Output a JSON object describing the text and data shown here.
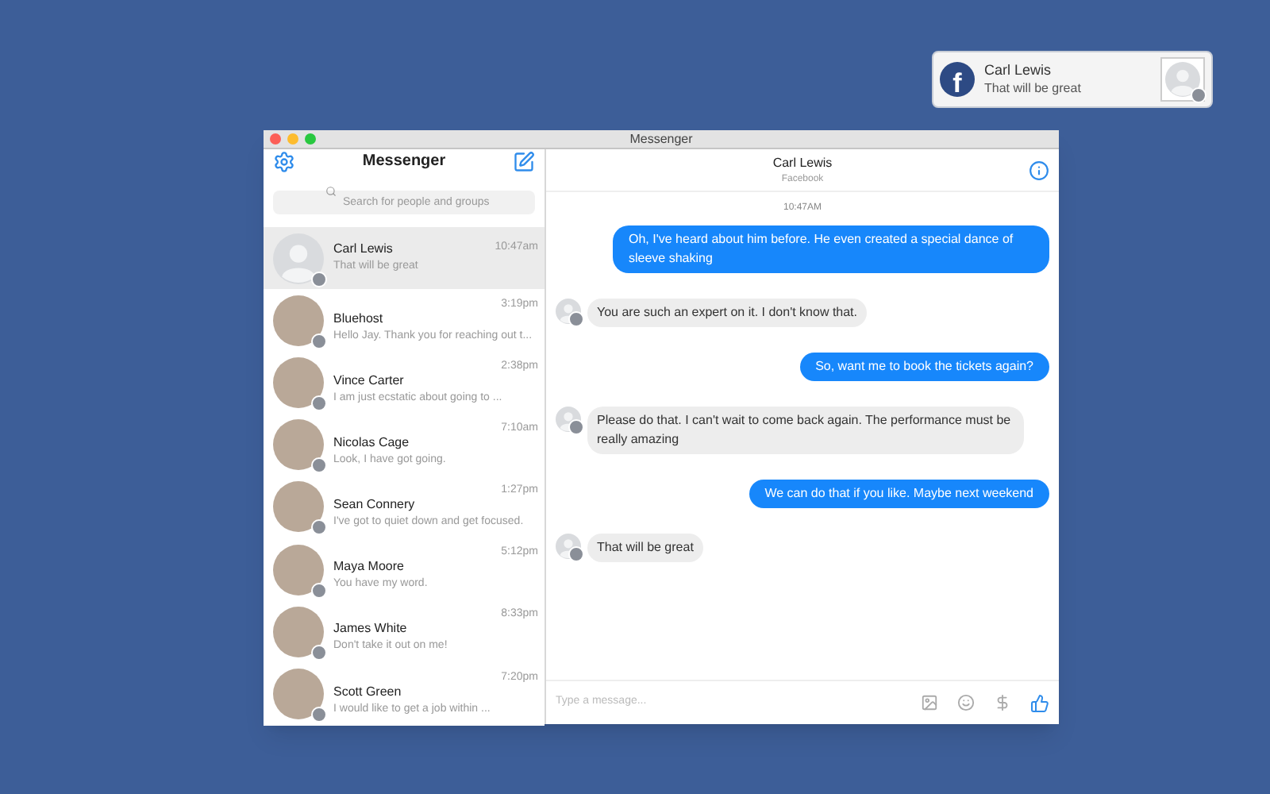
{
  "notification": {
    "app_glyph": "f",
    "name": "Carl Lewis",
    "text": "That will be great"
  },
  "window": {
    "title": "Messenger"
  },
  "sidebar": {
    "title": "Messenger",
    "search": {
      "placeholder": "Search for people and groups"
    },
    "conversations": [
      {
        "name": "Carl Lewis",
        "time": "10:47am",
        "preview": "That will be great",
        "selected": true,
        "kind": "silhouette"
      },
      {
        "name": "Bluehost",
        "time": "3:19pm",
        "preview": "Hello Jay. Thank you for reaching out t...",
        "selected": false,
        "kind": "photo"
      },
      {
        "name": "Vince Carter",
        "time": "2:38pm",
        "preview": "I am just ecstatic about going to ...",
        "selected": false,
        "kind": "photo"
      },
      {
        "name": "Nicolas Cage",
        "time": "7:10am",
        "preview": "Look, I have got going.",
        "selected": false,
        "kind": "photo"
      },
      {
        "name": "Sean Connery",
        "time": "1:27pm",
        "preview": "I've got to quiet down and get focused.",
        "selected": false,
        "kind": "photo"
      },
      {
        "name": "Maya Moore",
        "time": "5:12pm",
        "preview": "You have my word.",
        "selected": false,
        "kind": "photo"
      },
      {
        "name": "James White",
        "time": "8:33pm",
        "preview": "Don't take it out on me!",
        "selected": false,
        "kind": "photo"
      },
      {
        "name": "Scott Green",
        "time": "7:20pm",
        "preview": "I would like to get a job within ...",
        "selected": false,
        "kind": "photo"
      }
    ]
  },
  "chat": {
    "name": "Carl Lewis",
    "subtitle": "Facebook",
    "timestamp": "10:47AM",
    "messages": [
      {
        "kind": "outgoing",
        "text": "Oh, I've heard about him before. He even created a special dance of sleeve shaking"
      },
      {
        "kind": "incoming",
        "text": "You are such an expert on it. I don't know that."
      },
      {
        "kind": "outgoing",
        "text": "So, want me to book the tickets again?"
      },
      {
        "kind": "incoming",
        "text": "Please do that. I can't wait to come back again. The performance must be really amazing"
      },
      {
        "kind": "outgoing",
        "text": "We can do that if you like. Maybe next weekend"
      },
      {
        "kind": "incoming",
        "text": "That will be great"
      }
    ],
    "composer": {
      "placeholder": "Type a message..."
    }
  }
}
